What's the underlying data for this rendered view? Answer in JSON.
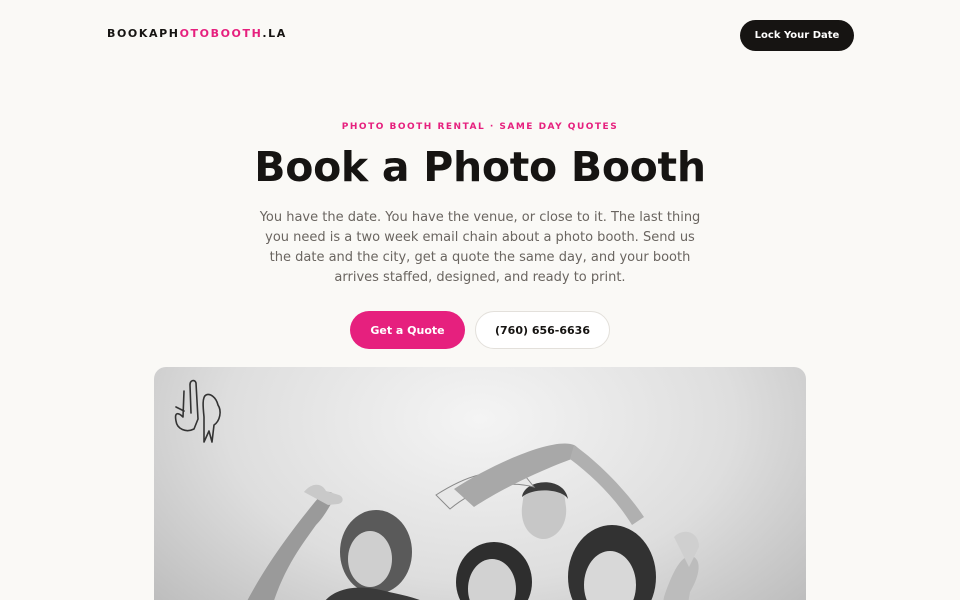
{
  "nav": {
    "logo_part1": "BOOKAPH",
    "logo_accent": "OTOBOOTH",
    "logo_part2": ".LA",
    "cta_label": "Lock Your Date"
  },
  "hero": {
    "eyebrow": "PHOTO BOOTH RENTAL · SAME DAY QUOTES",
    "title": "Book a Photo Booth",
    "lede": "You have the date. You have the venue, or close to it. The last thing you need is a two week email chain about a photo booth. Send us the date and the city, get a quote the same day, and your booth arrives staffed, designed, and ready to print.",
    "primary_cta": "Get a Quote",
    "secondary_cta": "(760) 656-6636"
  },
  "image": {
    "icon": "hand-sign-la-icon",
    "description_icon": "photo"
  },
  "colors": {
    "accent": "#e6207e",
    "dark": "#161412",
    "background": "#faf9f6",
    "body_text": "#6a6560"
  }
}
